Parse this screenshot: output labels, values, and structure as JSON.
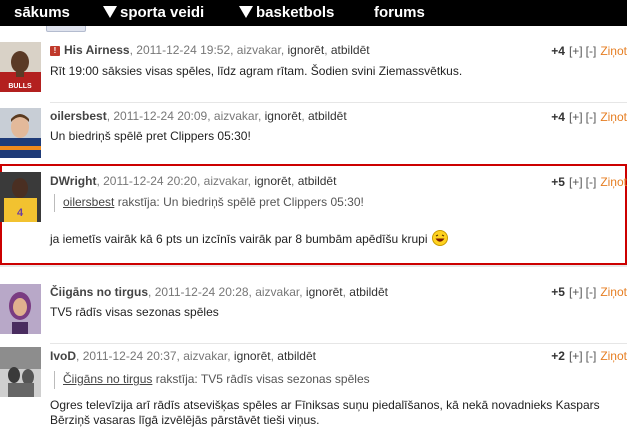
{
  "nav": {
    "home": "sākums",
    "sports": "sporta veidi",
    "basketball": "basketbols",
    "forums": "forums"
  },
  "labels": {
    "yesterday": "aizvakar",
    "ignore": "ignorēt",
    "reply": "atbildēt",
    "plus": "[+]",
    "minus": "[-]",
    "report": "Ziņot",
    "wrote": "rakstīja:"
  },
  "comments": [
    {
      "author": "His Airness",
      "date": "2011-12-24 19:52",
      "score": "+4",
      "text": "Rīt 19:00 sāksies visas spēles, līdz agram rītam. Šodien svini Ziemassvētkus.",
      "flagged": true
    },
    {
      "author": "oilersbest",
      "date": "2011-12-24 20:09",
      "score": "+4",
      "text": "Un biedriņš spēlē pret Clippers 05:30!"
    },
    {
      "author": "DWright",
      "date": "2011-12-24 20:20",
      "score": "+5",
      "quote_author": "oilersbest",
      "quote_text": "Un biedriņš spēlē pret Clippers 05:30!",
      "text": "ja iemetīs vairāk kā 6 pts un izcīnīs vairāk par 8 bumbām apēdīšu krupi",
      "emoticon": "laughing-smiley-icon"
    },
    {
      "author": "Čiigāns no tirgus",
      "date": "2011-12-24 20:28",
      "score": "+5",
      "text": "TV5 rādīs visas sezonas spēles"
    },
    {
      "author": "IvoD",
      "date": "2011-12-24 20:37",
      "score": "+2",
      "quote_author": "Čiigāns no tirgus",
      "quote_text": "TV5 rādīs visas sezonas spēles",
      "text": "Ogres televīzija arī rādīs atsevišķas spēles ar Fīniksas suņu piedalīšanos, kā nekā novadnieks Kaspars Bērziņš vasaras līgā izvēlējās pārstāvēt tieši viņus."
    }
  ],
  "colors": {
    "nav_bg": "#000000",
    "highlight_border": "#cc0000",
    "report_link": "#e67e22",
    "flag": "#c0392b"
  }
}
